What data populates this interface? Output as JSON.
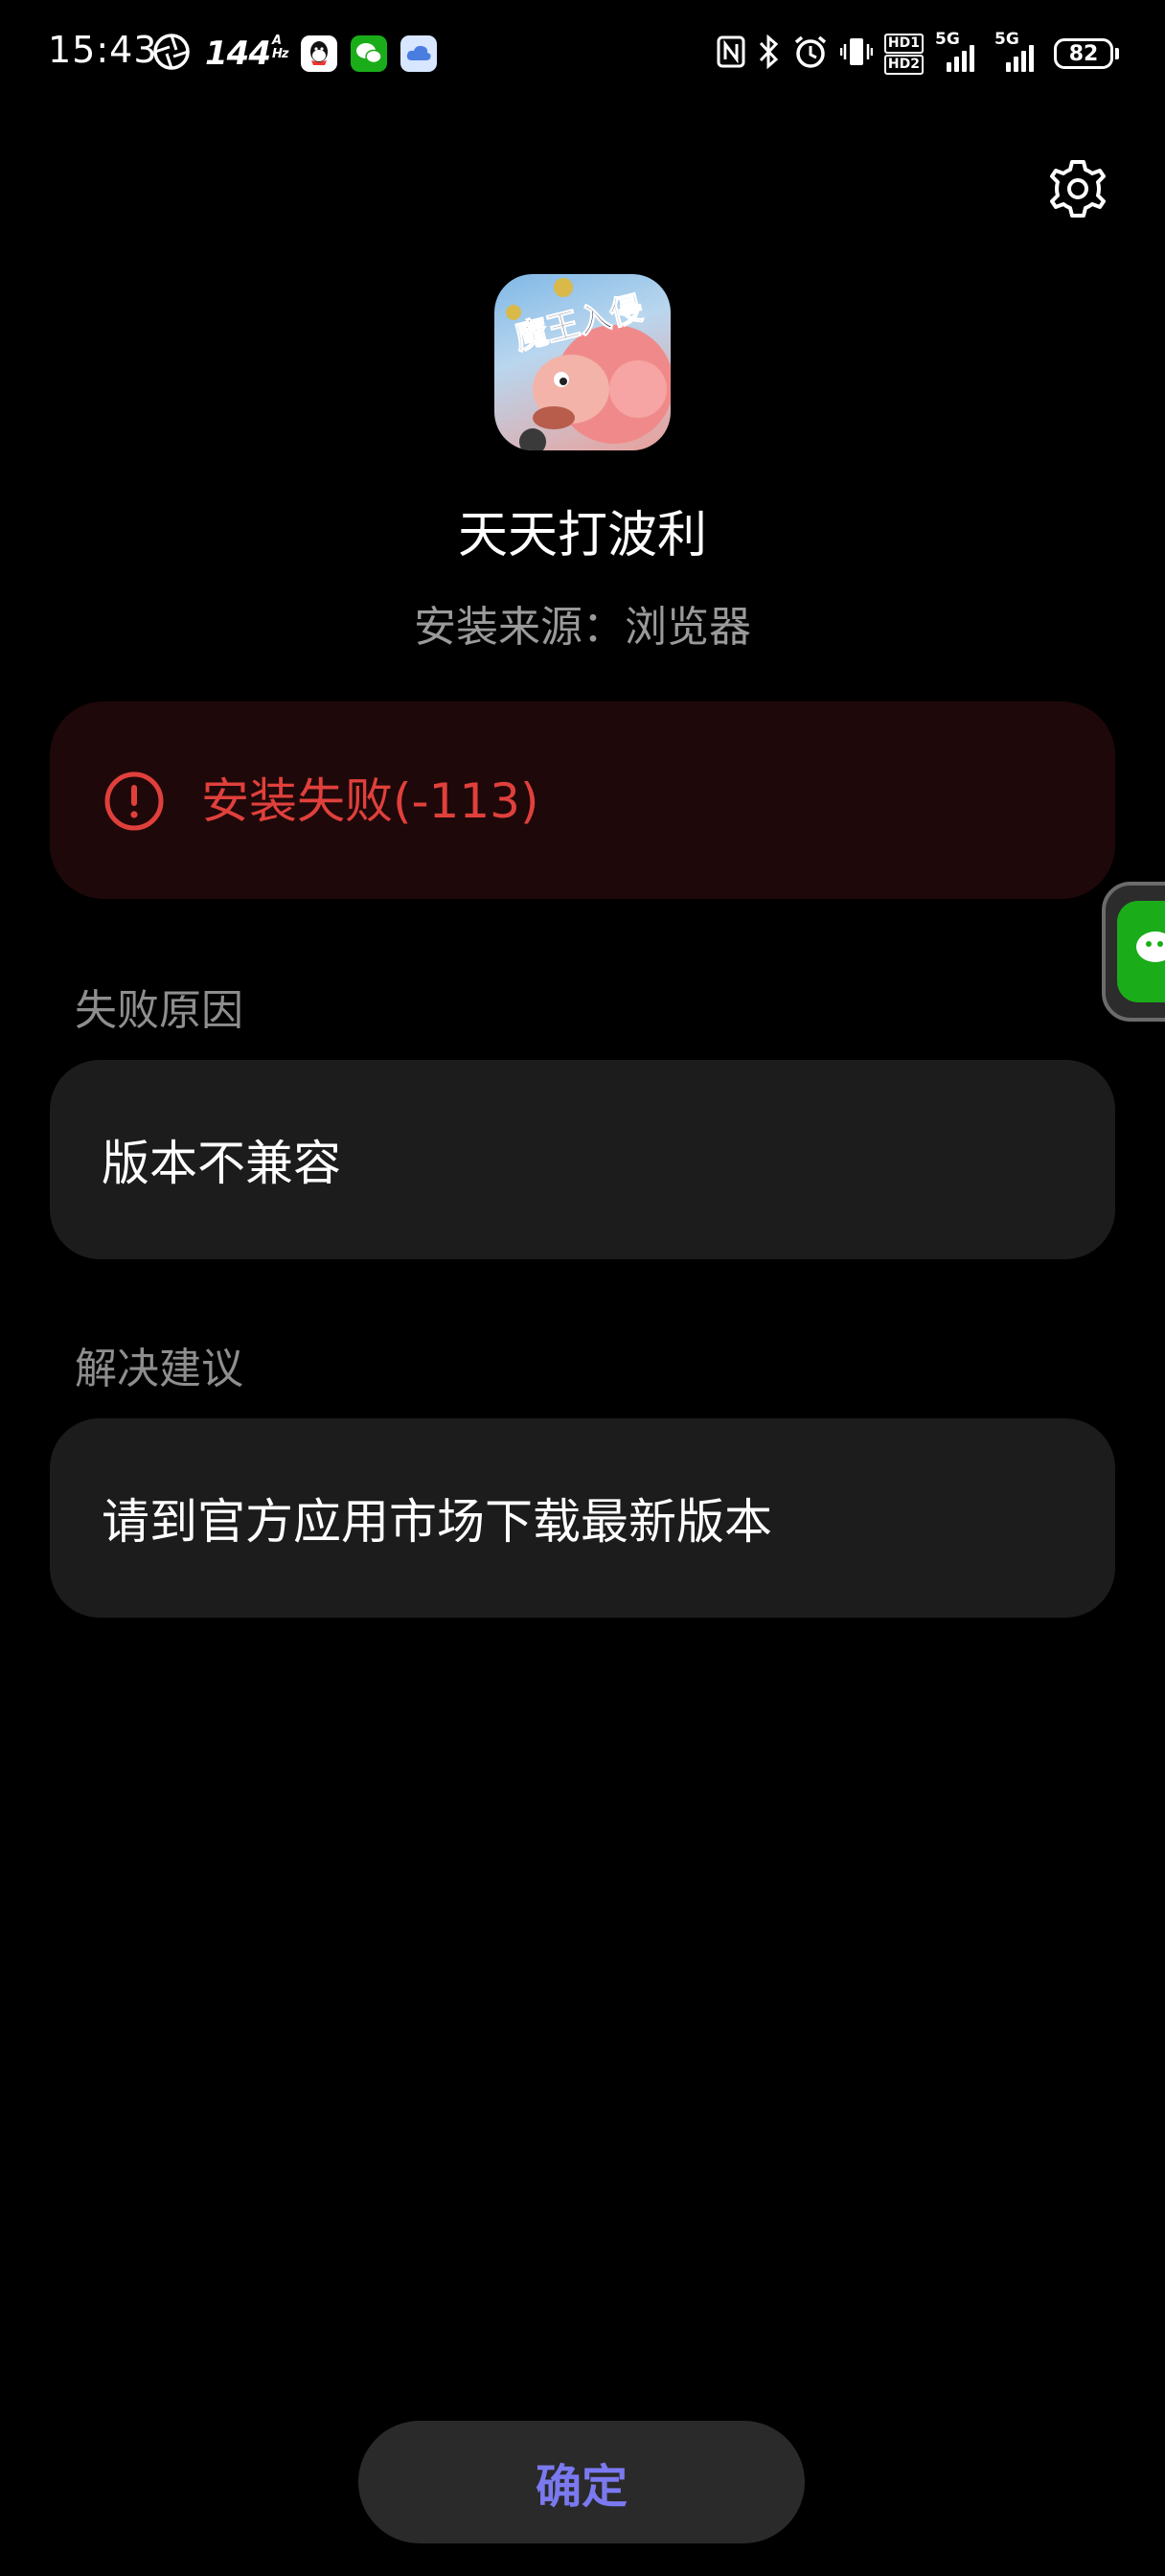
{
  "status_bar": {
    "time": "15:43",
    "refresh_rate": "144",
    "refresh_unit_top": "A",
    "refresh_unit_bottom": "Hz",
    "hd1": "HD1",
    "hd2": "HD2",
    "network_1": "5G",
    "network_2": "5G",
    "battery_level": "82",
    "left_icons": [
      "aperture-icon",
      "qq-icon",
      "wechat-icon",
      "cloud-icon"
    ],
    "right_icons": [
      "nfc-icon",
      "bluetooth-icon",
      "alarm-icon",
      "vibrate-icon"
    ]
  },
  "header": {
    "settings_icon": "gear-icon",
    "app_icon_text": "魔王入侵",
    "app_name": "天天打波利",
    "install_source": "安装来源：浏览器"
  },
  "error": {
    "icon": "alert-circle-icon",
    "message": "安装失败(-113)",
    "color": "#e0403c"
  },
  "failure_reason": {
    "label": "失败原因",
    "value": "版本不兼容"
  },
  "solution": {
    "label": "解决建议",
    "value": "请到官方应用市场下载最新版本"
  },
  "side_bubble": {
    "icon": "wechat-icon"
  },
  "footer": {
    "confirm_label": "确定",
    "accent_color": "#7b79f0"
  }
}
